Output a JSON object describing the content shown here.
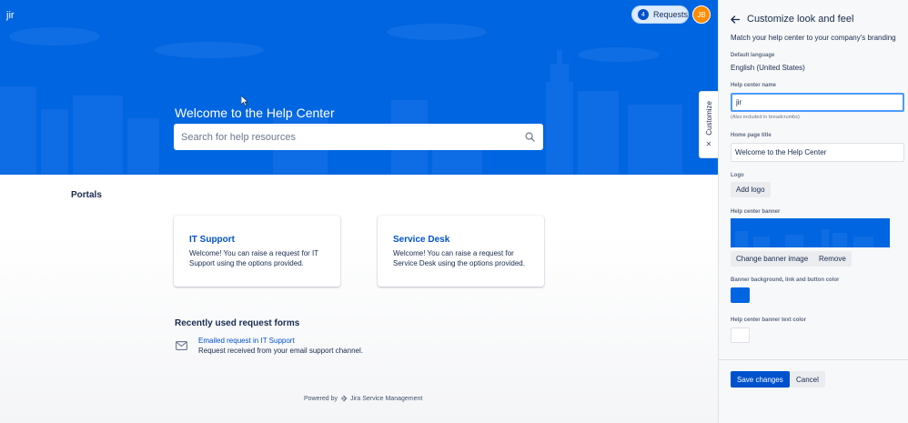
{
  "header": {
    "site_name": "jir",
    "requests_count": "4",
    "requests_label": "Requests",
    "avatar_initials": "JB"
  },
  "banner": {
    "welcome": "Welcome to the Help Center",
    "search_placeholder": "Search for help resources"
  },
  "customize_tab": {
    "label": "Customize",
    "close_glyph": "✕"
  },
  "portals": {
    "title": "Portals",
    "items": [
      {
        "name": "IT Support",
        "description": "Welcome! You can raise a request for IT Support using the options provided."
      },
      {
        "name": "Service Desk",
        "description": "Welcome! You can raise a request for Service Desk using the options provided."
      }
    ]
  },
  "recent": {
    "title": "Recently used request forms",
    "items": [
      {
        "name": "Emailed request in IT Support",
        "description": "Request received from your email support channel."
      }
    ]
  },
  "footer": {
    "powered_by": "Powered by",
    "product": "Jira Service Management"
  },
  "panel": {
    "title": "Customize look and feel",
    "subtitle": "Match your help center to your company's branding",
    "language_label": "Default language",
    "language_value": "English (United States)",
    "name_label": "Help center name",
    "name_value": "jir",
    "name_hint": "(Also included in breadcrumbs)",
    "home_title_label": "Home page title",
    "home_title_value": "Welcome to the Help Center",
    "logo_label": "Logo",
    "add_logo": "Add logo",
    "banner_label": "Help center banner",
    "change_banner": "Change banner image",
    "remove": "Remove",
    "color_label": "Banner background, link and button color",
    "text_color_label": "Help center banner text color",
    "save": "Save changes",
    "cancel": "Cancel"
  },
  "colors": {
    "banner": "#0065e0",
    "link": "#0052cc",
    "primary_button": "#0052cc",
    "avatar": "#ff8b00",
    "banner_text_swatch": "#ffffff"
  }
}
